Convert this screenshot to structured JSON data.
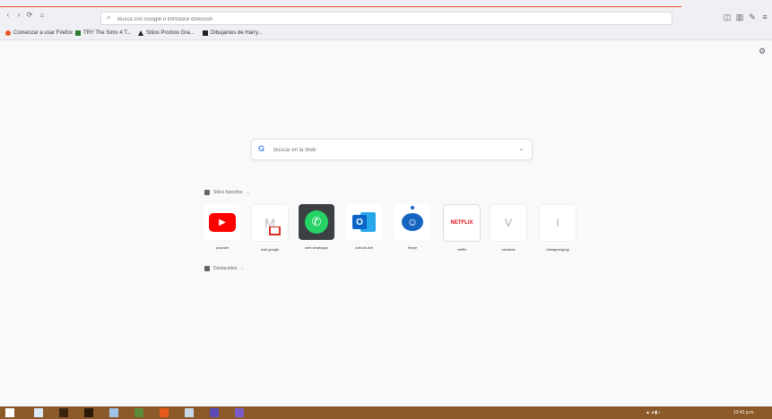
{
  "colors": {
    "accent": "#e8562a",
    "youtube": "#ff0000",
    "whatsapp": "#25d366",
    "whatsapp_bg": "#3c4043",
    "outlook": "#0a64c8",
    "netflix": "#e50914",
    "taskbar": "#8b5a28"
  },
  "toolbar": {
    "back_icon": "‹",
    "forward_icon": "›",
    "reload_icon": "⟳",
    "home_icon": "⌂",
    "url_placeholder": "Busca con Google o introduce dirección",
    "pocket_icon": "◫",
    "sidebar_icon": "▥",
    "extensions_icon": "✎",
    "menu_icon": "≡"
  },
  "bookmarks": [
    {
      "label": "Comenzar a usar Firefox",
      "color": "#e8562a"
    },
    {
      "label": "TRY The Sims 4 T...",
      "color": "#2e7d32"
    },
    {
      "label": "Sitios Promos Gra...",
      "color": "#222222"
    },
    {
      "label": "Dibujantes de Harry...",
      "color": "#222222"
    }
  ],
  "search": {
    "placeholder": "Buscar en la Web",
    "g_label": "G",
    "mic_icon": "⌄"
  },
  "top_sites": {
    "title": "Sitios favoritos",
    "chevron": "⌄",
    "tiles": [
      {
        "label": "youtube",
        "glyph": "▶"
      },
      {
        "label": "mail.google",
        "glyph": "M"
      },
      {
        "label": "web.whatsapp",
        "glyph": "✆"
      },
      {
        "label": "outlook.live",
        "glyph": "O"
      },
      {
        "label": "fixeye",
        "glyph": "☺"
      },
      {
        "label": "netflix",
        "glyph": "NETFLIX"
      },
      {
        "label": "vanadas",
        "glyph": "V"
      },
      {
        "label": "instagramgogi",
        "glyph": "I"
      }
    ]
  },
  "highlights": {
    "title": "Destacados",
    "chevron": "⌄"
  },
  "settings_icon": "⚙",
  "taskbar": {
    "clock": "12:41 p.m.",
    "tray_icons": "▲ ◂ ▮ ♪"
  }
}
